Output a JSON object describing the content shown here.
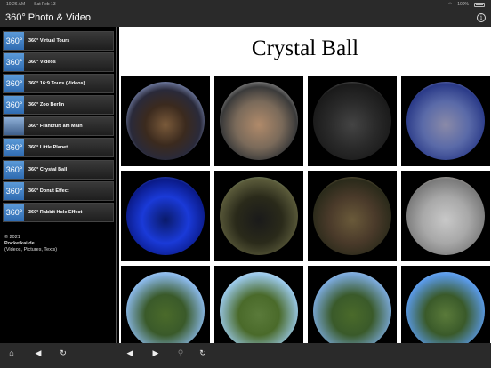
{
  "status": {
    "time": "10:26 AM",
    "date": "Sat Feb 13",
    "battery": "100%"
  },
  "app": {
    "title": "360° Photo & Video"
  },
  "sidebar": {
    "items": [
      {
        "label": "360° Virtual Tours",
        "icon": "360-icon",
        "badge": "360°"
      },
      {
        "label": "360° Videos",
        "icon": "360-icon",
        "badge": "360°"
      },
      {
        "label": "360° 16:9 Tours (Videos)",
        "icon": "360-icon",
        "badge": "360°"
      },
      {
        "label": "360° Zoo Berlin",
        "icon": "360-icon",
        "badge": "360°"
      },
      {
        "label": "360° Frankfurt am Main",
        "icon": "photo-icon",
        "badge": ""
      },
      {
        "label": "360° Little Planet",
        "icon": "360-icon",
        "badge": "360°"
      },
      {
        "label": "360° Crystal Ball",
        "icon": "360-icon",
        "badge": "360°"
      },
      {
        "label": "360° Donut Effect",
        "icon": "360-icon",
        "badge": "360°"
      },
      {
        "label": "360° Rabbit Hole Effect",
        "icon": "360-icon",
        "badge": "360°"
      }
    ],
    "copyright": {
      "line1": "© 2021",
      "line2": "Pocketkai.de",
      "line3": "(Videos, Pictures, Texts)"
    }
  },
  "main": {
    "title": "Crystal Ball"
  },
  "toolbar": {
    "home": "⌂",
    "back_left": "◀",
    "reload_left": "↻",
    "back": "◀",
    "forward": "▶",
    "search": "⚲",
    "reload": "↻"
  }
}
